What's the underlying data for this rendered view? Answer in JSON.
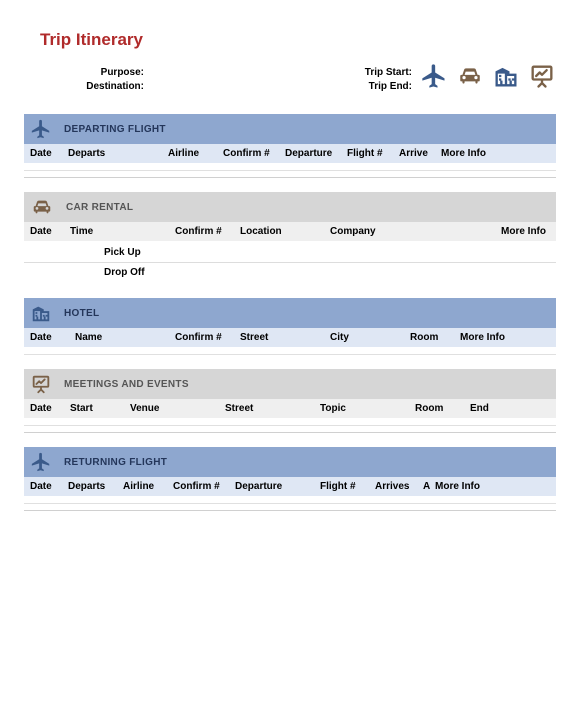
{
  "title": "Trip Itinerary",
  "meta": {
    "purpose_label": "Purpose:",
    "destination_label": "Destination:",
    "trip_start_label": "Trip Start:",
    "trip_end_label": "Trip End:"
  },
  "colors": {
    "blue_header": "#8ea7cf",
    "blue_cols": "#dfe7f4",
    "grey_header": "#d6d6d6",
    "grey_cols": "#efefef",
    "icon_blue": "#3a5a8a",
    "icon_brown": "#7a6148"
  },
  "sections": {
    "departing": {
      "title": "DEPARTING FLIGHT",
      "cols": [
        "Date",
        "Departs",
        "Airline",
        "Confirm #",
        "Departure",
        "Flight #",
        "Arrive",
        "More Info"
      ]
    },
    "car": {
      "title": "CAR RENTAL",
      "cols": [
        "Date",
        "Time",
        "Confirm #",
        "Location",
        "Company",
        "More Info"
      ],
      "subrows": [
        "Pick Up",
        "Drop Off"
      ]
    },
    "hotel": {
      "title": "HOTEL",
      "cols": [
        "Date",
        "Name",
        "Confirm #",
        "Street",
        "City",
        "Room",
        "More Info"
      ]
    },
    "meetings": {
      "title": "MEETINGS AND EVENTS",
      "cols": [
        "Date",
        "Start",
        "Venue",
        "Street",
        "Topic",
        "Room",
        "End"
      ]
    },
    "returning": {
      "title": "RETURNING FLIGHT",
      "cols": [
        "Date",
        "Departs",
        "Airline",
        "Confirm #",
        "Departure",
        "Flight #",
        "Arrives",
        "A",
        "More Info"
      ]
    }
  }
}
